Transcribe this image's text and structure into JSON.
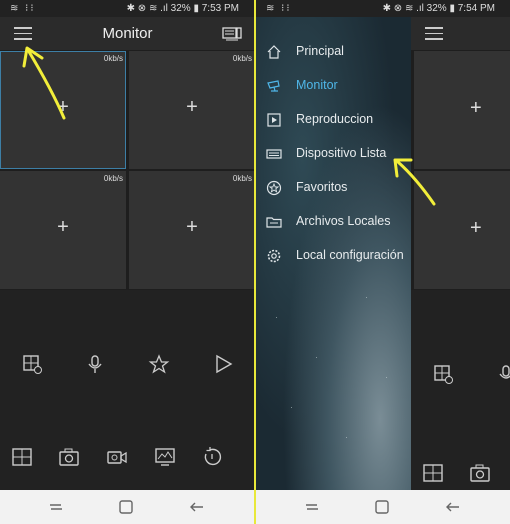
{
  "left": {
    "status": {
      "time": "7:53 PM",
      "battery": "32%"
    },
    "title": "Monitor",
    "cells": [
      {
        "speed": "0kb/s",
        "plus": "+"
      },
      {
        "speed": "0kb/s",
        "plus": "+"
      },
      {
        "speed": "0kb/s",
        "plus": "+"
      },
      {
        "speed": "0kb/s",
        "plus": "+"
      }
    ]
  },
  "right": {
    "status": {
      "time": "7:54 PM",
      "battery": "32%"
    },
    "menu": [
      {
        "label": "Principal",
        "icon": "home-icon"
      },
      {
        "label": "Monitor",
        "icon": "camera-icon",
        "active": true
      },
      {
        "label": "Reproduccion",
        "icon": "playback-icon"
      },
      {
        "label": "Dispositivo Lista",
        "icon": "device-list-icon"
      },
      {
        "label": "Favoritos",
        "icon": "star-icon"
      },
      {
        "label": "Archivos Locales",
        "icon": "folder-icon"
      },
      {
        "label": "Local configuración",
        "icon": "gear-icon"
      }
    ],
    "plus": [
      "+",
      "+"
    ]
  },
  "colors": {
    "accent": "#4fb6e8",
    "annotation": "#e8e83a",
    "selected_outline": "#3d7fa6"
  }
}
